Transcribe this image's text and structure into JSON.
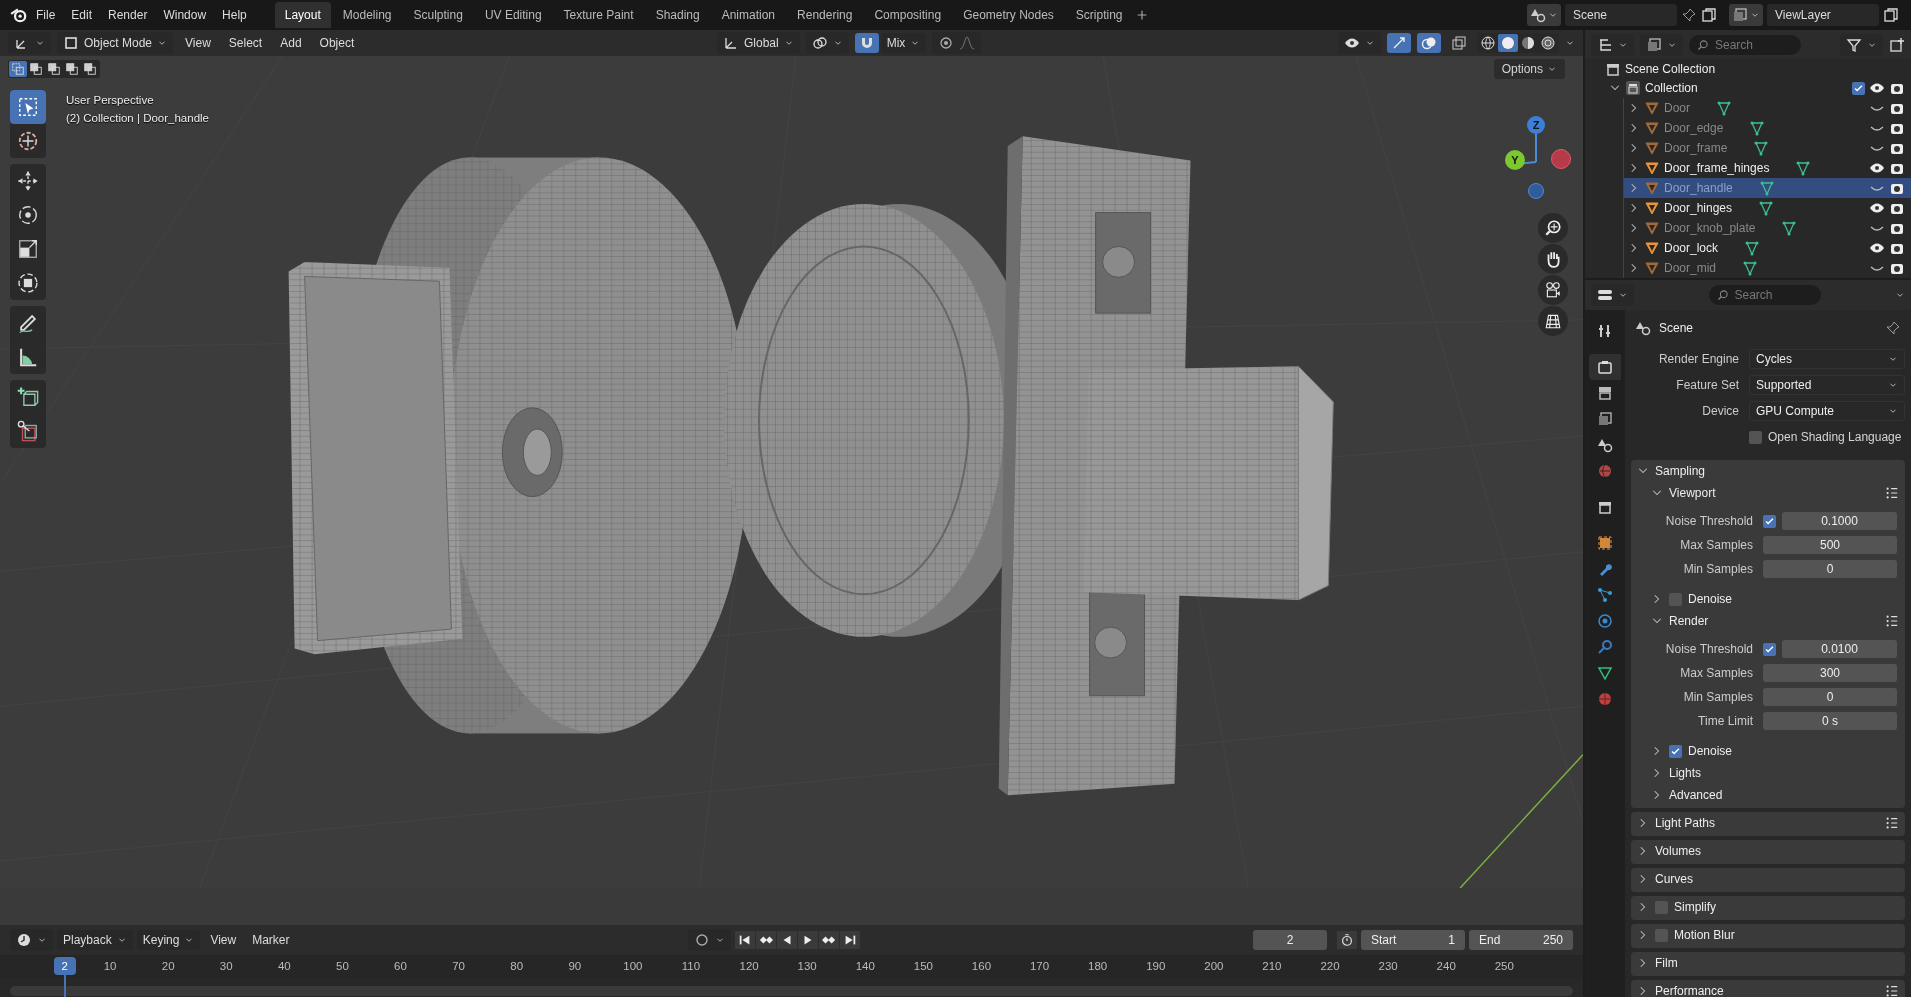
{
  "menu": [
    "File",
    "Edit",
    "Render",
    "Window",
    "Help"
  ],
  "workspaces": [
    {
      "label": "Layout",
      "selected": true
    },
    {
      "label": "Modeling",
      "selected": false
    },
    {
      "label": "Sculpting",
      "selected": false
    },
    {
      "label": "UV Editing",
      "selected": false
    },
    {
      "label": "Texture Paint",
      "selected": false
    },
    {
      "label": "Shading",
      "selected": false
    },
    {
      "label": "Animation",
      "selected": false
    },
    {
      "label": "Rendering",
      "selected": false
    },
    {
      "label": "Compositing",
      "selected": false
    },
    {
      "label": "Geometry Nodes",
      "selected": false
    },
    {
      "label": "Scripting",
      "selected": false
    }
  ],
  "scene": "Scene",
  "view_layer": "ViewLayer",
  "viewport": {
    "mode": "Object Mode",
    "menus": [
      "View",
      "Select",
      "Add",
      "Object"
    ],
    "orientation": "Global",
    "snap_target": "Mix",
    "options": "Options",
    "select_modes": [
      {
        "selected": true
      },
      {
        "selected": false
      },
      {
        "selected": false
      },
      {
        "selected": false
      },
      {
        "selected": false
      }
    ],
    "toggles": [
      {
        "on": true
      },
      {
        "on": true
      },
      {
        "on": false
      }
    ],
    "shading_modes": [
      {
        "selected": false
      },
      {
        "selected": true
      },
      {
        "selected": false
      },
      {
        "selected": false
      }
    ],
    "tools": [
      {
        "selected": true
      },
      {
        "selected": false
      },
      {
        "selected": false
      },
      {
        "selected": false
      },
      {
        "selected": false
      },
      {
        "selected": false
      },
      {
        "selected": false
      },
      {
        "selected": false
      },
      {
        "selected": false
      },
      {
        "selected": false
      }
    ],
    "overlay_text": [
      "User Perspective",
      "(2) Collection | Door_handle"
    ],
    "gizmo_labels": [
      "Z",
      "Y"
    ]
  },
  "outliner": {
    "search_placeholder": "Search",
    "scene_collection": "Scene Collection",
    "collection": {
      "name": "Collection",
      "expanded": true,
      "checked": true,
      "children": [
        {
          "name": "Door",
          "selected": false,
          "visible": false
        },
        {
          "name": "Door_edge",
          "selected": false,
          "visible": false
        },
        {
          "name": "Door_frame",
          "selected": false,
          "visible": false
        },
        {
          "name": "Door_frame_hinges",
          "selected": false,
          "visible": true
        },
        {
          "name": "Door_handle",
          "selected": true,
          "visible": false
        },
        {
          "name": "Door_hinges",
          "selected": false,
          "visible": true
        },
        {
          "name": "Door_knob_plate",
          "selected": false,
          "visible": false
        },
        {
          "name": "Door_lock",
          "selected": false,
          "visible": true
        },
        {
          "name": "Door_mid",
          "selected": false,
          "visible": false
        }
      ]
    }
  },
  "properties": {
    "search_placeholder": "Search",
    "context": "Scene",
    "tabs": [
      {
        "selected": false
      },
      {
        "selected": true
      },
      {
        "selected": false
      },
      {
        "selected": false
      },
      {
        "selected": false
      },
      {
        "selected": false
      },
      {
        "selected": false
      },
      {
        "selected": false
      },
      {
        "selected": false
      },
      {
        "selected": false
      },
      {
        "selected": false
      },
      {
        "selected": false
      },
      {
        "selected": false
      },
      {
        "selected": false
      }
    ],
    "fields": [
      {
        "kind": "dropdown",
        "label": "Render Engine",
        "value": "Cycles"
      },
      {
        "kind": "dropdown",
        "label": "Feature Set",
        "value": "Supported"
      },
      {
        "kind": "dropdown",
        "label": "Device",
        "value": "GPU Compute"
      },
      {
        "kind": "checkbox",
        "label": "Open Shading Language",
        "checked": false
      }
    ],
    "panels": [
      {
        "title": "Sampling",
        "expanded": true,
        "children": [
          {
            "title": "Viewport",
            "expanded": true,
            "presets": true,
            "rows": [
              {
                "kind": "check_number",
                "label": "Noise Threshold",
                "checked": true,
                "value": "0.1000"
              },
              {
                "kind": "number",
                "label": "Max Samples",
                "value": "500"
              },
              {
                "kind": "number",
                "label": "Min Samples",
                "value": "0"
              }
            ]
          },
          {
            "title": "Denoise",
            "expanded": false,
            "checked": false
          },
          {
            "title": "Render",
            "expanded": true,
            "presets": true,
            "rows": [
              {
                "kind": "check_number",
                "label": "Noise Threshold",
                "checked": true,
                "value": "0.0100"
              },
              {
                "kind": "number",
                "label": "Max Samples",
                "value": "300"
              },
              {
                "kind": "number",
                "label": "Min Samples",
                "value": "0"
              },
              {
                "kind": "number",
                "label": "Time Limit",
                "value": "0 s"
              }
            ]
          },
          {
            "title": "Denoise",
            "expanded": false,
            "checked": true
          },
          {
            "title": "Lights",
            "expanded": false
          },
          {
            "title": "Advanced",
            "expanded": false
          }
        ]
      },
      {
        "title": "Light Paths",
        "expanded": false,
        "presets": true
      },
      {
        "title": "Volumes",
        "expanded": false
      },
      {
        "title": "Curves",
        "expanded": false
      },
      {
        "title": "Simplify",
        "expanded": false,
        "checked": false
      },
      {
        "title": "Motion Blur",
        "expanded": false,
        "checked": false
      },
      {
        "title": "Film",
        "expanded": false
      },
      {
        "title": "Performance",
        "expanded": false,
        "presets": true
      }
    ]
  },
  "timeline": {
    "menus": [
      "Playback",
      "Keying",
      "View",
      "Marker"
    ],
    "current_frame": "2",
    "start_label": "Start",
    "start": "1",
    "end_label": "End",
    "end": "250",
    "playhead": "2",
    "ruler": [
      "10",
      "20",
      "30",
      "40",
      "50",
      "60",
      "70",
      "80",
      "90",
      "100",
      "110",
      "120",
      "130",
      "140",
      "150",
      "160",
      "170",
      "180",
      "190",
      "200",
      "210",
      "220",
      "230",
      "240",
      "250"
    ]
  }
}
